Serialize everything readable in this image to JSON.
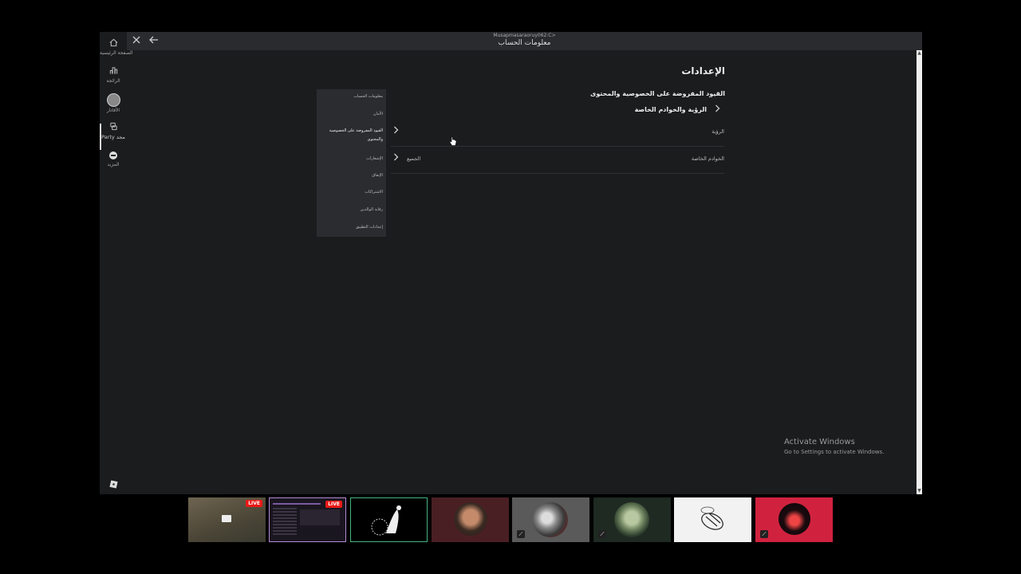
{
  "window": {
    "subtitle": "Musapmasaraoruy062:C>",
    "title": "معلومات الحساب"
  },
  "rail": {
    "items": [
      {
        "label": "الصفحة الرئيسية"
      },
      {
        "label": "الرائجة"
      },
      {
        "label": "الأفاتار"
      },
      {
        "label": "Party مجد"
      },
      {
        "label": "المزيد"
      }
    ]
  },
  "settings": {
    "title": "الإعدادات",
    "section_title": "القيود المفروضة على الخصوصية والمحتوى",
    "breadcrumb": "الرؤية والخوادم الخاصة",
    "menu": [
      {
        "label": "معلومات الحساب"
      },
      {
        "label": "الأمان"
      },
      {
        "label": "القيود المفروضة على الخصوصية والمحتوى",
        "active": true
      },
      {
        "label": "الإشعارات"
      },
      {
        "label": "الإنفاق"
      },
      {
        "label": "الاشتراكات"
      },
      {
        "label": "رقابة الوالدين"
      },
      {
        "label": "إعدادات التطبيق"
      }
    ],
    "rows": [
      {
        "label": "الرؤية",
        "value": ""
      },
      {
        "label": "الخوادم الخاصة",
        "value": "الجميع"
      }
    ]
  },
  "watermark": {
    "title": "Activate Windows",
    "subtitle": "Go to Settings to activate Windows."
  },
  "stream_tiles": {
    "live_label": "LIVE"
  }
}
